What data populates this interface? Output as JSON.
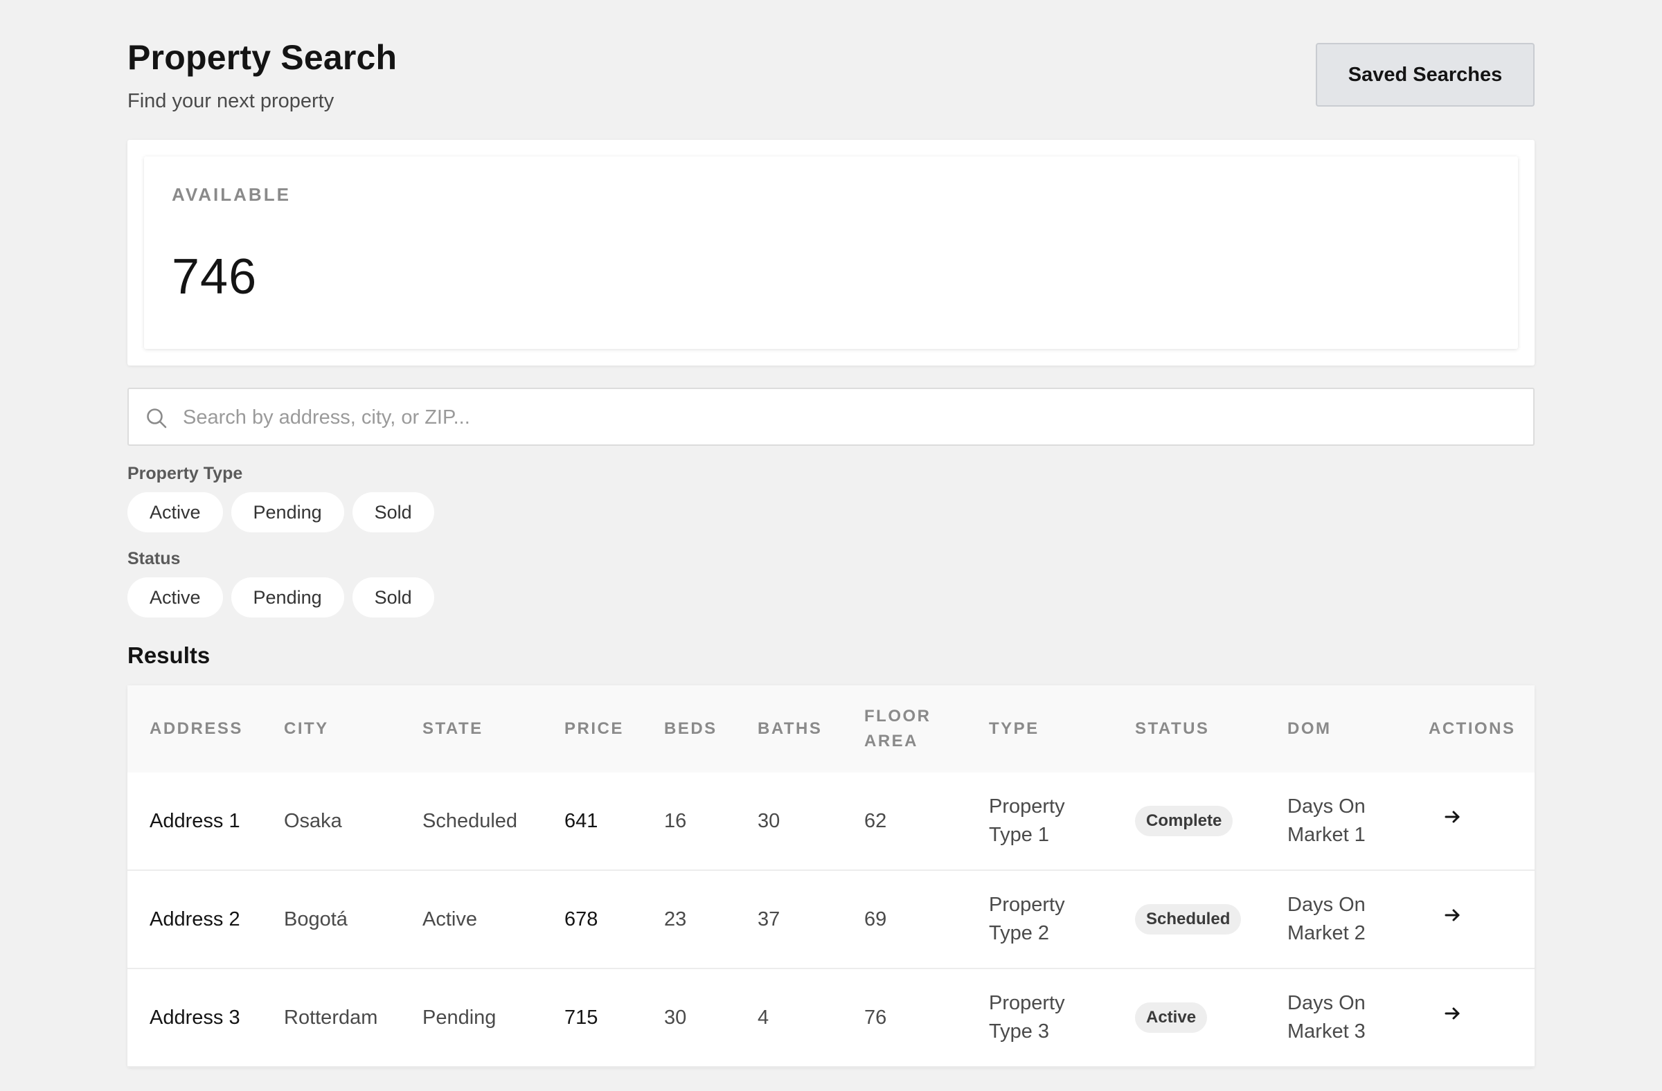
{
  "header": {
    "title": "Property Search",
    "subtitle": "Find your next property",
    "saved_searches_label": "Saved Searches"
  },
  "stats": {
    "label": "AVAILABLE",
    "value": "746"
  },
  "search": {
    "placeholder": "Search by address, city, or ZIP...",
    "value": ""
  },
  "filters": [
    {
      "label": "Property Type",
      "options": [
        "Active",
        "Pending",
        "Sold"
      ]
    },
    {
      "label": "Status",
      "options": [
        "Active",
        "Pending",
        "Sold"
      ]
    }
  ],
  "results": {
    "title": "Results",
    "columns": {
      "address": "ADDRESS",
      "city": "CITY",
      "state": "STATE",
      "price": "PRICE",
      "beds": "BEDS",
      "baths": "BATHS",
      "floor_area": "FLOOR AREA",
      "type": "TYPE",
      "status": "STATUS",
      "dom": "DOM",
      "actions": "ACTIONS"
    },
    "rows": [
      {
        "address": "Address 1",
        "city": "Osaka",
        "state": "Scheduled",
        "price": "641",
        "beds": "16",
        "baths": "30",
        "floor_area": "62",
        "type": "Property Type 1",
        "status": "Complete",
        "dom": "Days On Market 1",
        "action_icon": "arrow-right-icon"
      },
      {
        "address": "Address 2",
        "city": "Bogotá",
        "state": "Active",
        "price": "678",
        "beds": "23",
        "baths": "37",
        "floor_area": "69",
        "type": "Property Type 2",
        "status": "Scheduled",
        "dom": "Days On Market 2",
        "action_icon": "arrow-right-icon"
      },
      {
        "address": "Address 3",
        "city": "Rotterdam",
        "state": "Pending",
        "price": "715",
        "beds": "30",
        "baths": "4",
        "floor_area": "76",
        "type": "Property Type 3",
        "status": "Active",
        "dom": "Days On Market 3",
        "action_icon": "arrow-right-icon"
      }
    ]
  },
  "icons": {
    "search": "search-icon"
  },
  "colors": {
    "background": "#f1f1f1",
    "card": "#ffffff",
    "button_bg": "#e3e5e8",
    "badge_bg": "#eeeeee",
    "muted_text": "#8a8a8a"
  }
}
